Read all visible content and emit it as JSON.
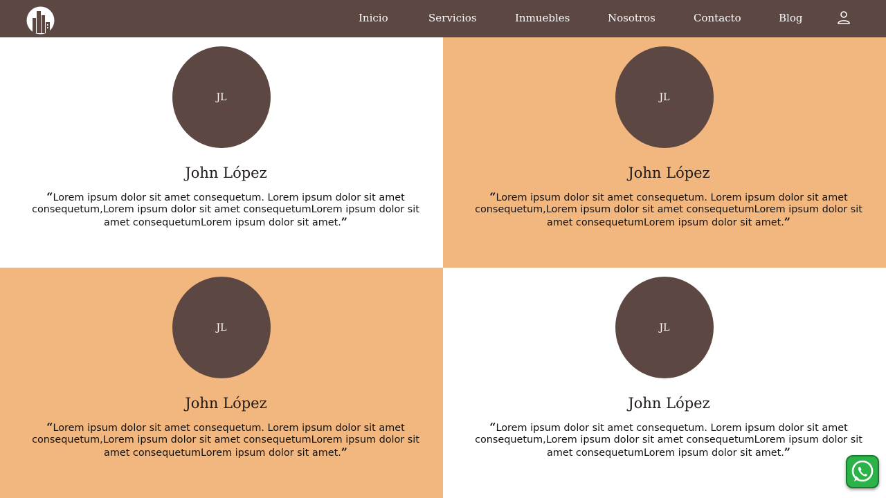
{
  "colors": {
    "nav_bg": "#5c4742",
    "card_light": "#ffffff",
    "card_accent": "#f2b77f",
    "avatar_bg": "#5c4742",
    "whatsapp": "#2bb34a"
  },
  "header": {
    "logo_icon": "building-logo-icon",
    "nav": [
      {
        "label": "Inicio"
      },
      {
        "label": "Servicios"
      },
      {
        "label": "Inmuebles"
      },
      {
        "label": "Nosotros"
      },
      {
        "label": "Contacto"
      },
      {
        "label": "Blog"
      }
    ],
    "user_icon": "user-icon"
  },
  "testimonials": [
    {
      "initials": "JL",
      "name": "John López",
      "open_quote": "“",
      "text": "Lorem ipsum dolor sit amet consequetum. Lorem ipsum dolor sit amet consequetum,Lorem ipsum dolor sit amet consequetumLorem ipsum dolor sit amet consequetumLorem ipsum dolor sit amet.",
      "close_quote": "”",
      "background": "#ffffff"
    },
    {
      "initials": "JL",
      "name": "John López",
      "open_quote": "“",
      "text": "Lorem ipsum dolor sit amet consequetum. Lorem ipsum dolor sit amet consequetum,Lorem ipsum dolor sit amet consequetumLorem ipsum dolor sit amet consequetumLorem ipsum dolor sit amet.",
      "close_quote": "”",
      "background": "#f2b77f"
    },
    {
      "initials": "JL",
      "name": "John López",
      "open_quote": "“",
      "text": "Lorem ipsum dolor sit amet consequetum. Lorem ipsum dolor sit amet consequetum,Lorem ipsum dolor sit amet consequetumLorem ipsum dolor sit amet consequetumLorem ipsum dolor sit amet.",
      "close_quote": "”",
      "background": "#f2b77f"
    },
    {
      "initials": "JL",
      "name": "John López",
      "open_quote": "“",
      "text": "Lorem ipsum dolor sit amet consequetum. Lorem ipsum dolor sit amet consequetum,Lorem ipsum dolor sit amet consequetumLorem ipsum dolor sit amet consequetumLorem ipsum dolor sit amet.",
      "close_quote": "”",
      "background": "#ffffff"
    }
  ],
  "whatsapp_button": {
    "icon": "whatsapp-icon"
  }
}
